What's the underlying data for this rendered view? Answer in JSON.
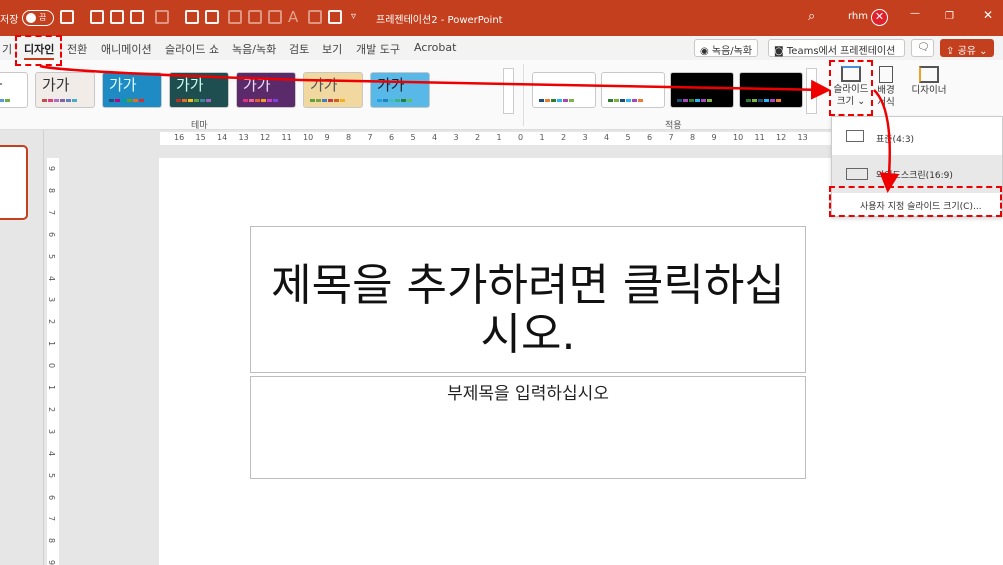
{
  "titlebar": {
    "autosave_label": "저장",
    "toggle_state": "끔",
    "doc_title": "프레젠테이션2 - PowerPoint",
    "user": "rhm",
    "colors": {
      "accent": "#c33f1d"
    }
  },
  "tabs": [
    {
      "label": "기"
    },
    {
      "label": "디자인",
      "active": true
    },
    {
      "label": "전환"
    },
    {
      "label": "애니메이션"
    },
    {
      "label": "슬라이드 쇼"
    },
    {
      "label": "녹음/녹화"
    },
    {
      "label": "검토"
    },
    {
      "label": "보기"
    },
    {
      "label": "개발 도구"
    },
    {
      "label": "Acrobat"
    }
  ],
  "tab_buttons": {
    "record": "◉ 녹음/녹화",
    "teams": "Teams에서 프레젠테이션",
    "comment": "🗨",
    "share": "공유 ⌄"
  },
  "ribbon": {
    "themes_group": "테마",
    "theme_sample": "가가",
    "variants_group": "적용",
    "slide_size": {
      "line1": "슬라이드",
      "line2": "크기 ⌄"
    },
    "format_bg": {
      "line1": "배경",
      "line2": "서식"
    },
    "designer": "디자이너"
  },
  "slide_size_menu": [
    {
      "label": "표준(4:3)"
    },
    {
      "label": "와이드스크린(16:9)"
    },
    {
      "label": "사용자 지정 슬라이드 크기(C)..."
    }
  ],
  "hruler": [
    "16",
    "15",
    "14",
    "13",
    "12",
    "11",
    "10",
    "9",
    "8",
    "7",
    "6",
    "5",
    "4",
    "3",
    "2",
    "1",
    "0",
    "1",
    "2",
    "3",
    "4",
    "5",
    "6",
    "7",
    "8",
    "9",
    "10",
    "11",
    "12",
    "13"
  ],
  "vruler": [
    "9",
    "8",
    "7",
    "6",
    "5",
    "4",
    "3",
    "2",
    "1",
    "0",
    "1",
    "2",
    "3",
    "4",
    "5",
    "6",
    "7",
    "8",
    "9"
  ],
  "slide": {
    "title_placeholder": "제목을 추가하려면 클릭하십시오.",
    "subtitle_placeholder": "부제목을 입력하십시오"
  }
}
